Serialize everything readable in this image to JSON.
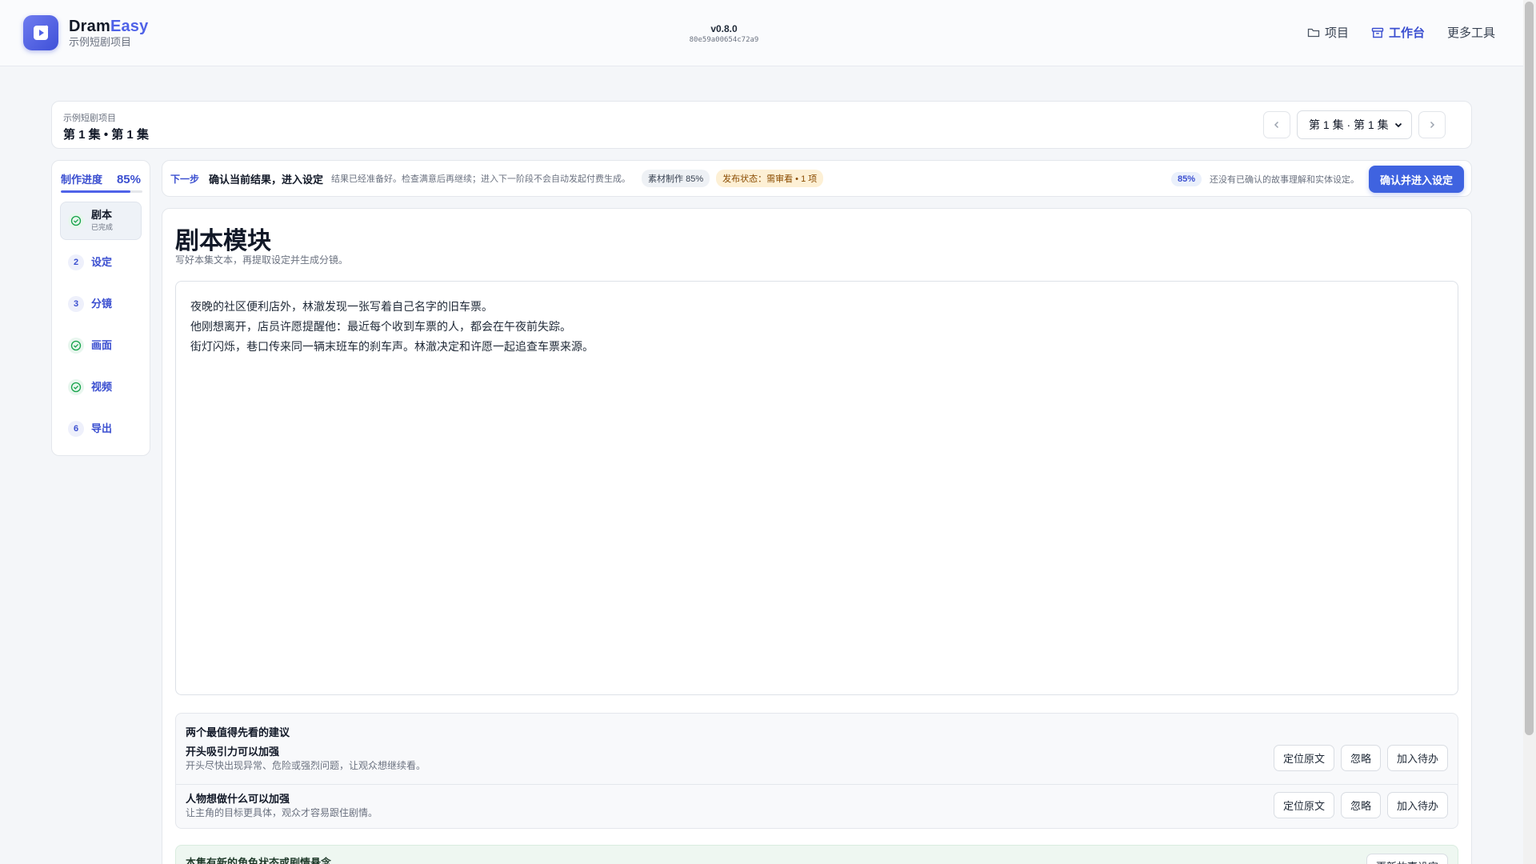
{
  "header": {
    "brand_main": "Dram",
    "brand_accent": "Easy",
    "project_name": "示例短剧项目",
    "version": "v0.8.0",
    "build_hash": "80e59a00654c72a9",
    "nav": [
      {
        "label": "项目",
        "icon": "folder-icon"
      },
      {
        "label": "工作台",
        "icon": "archive-icon",
        "active": true
      },
      {
        "label": "更多工具"
      }
    ]
  },
  "episode": {
    "project_label": "示例短剧项目",
    "title": "第 1 集 • 第 1 集",
    "selector_value": "第 1 集 · 第 1 集"
  },
  "sidebar": {
    "progress_label": "制作进度",
    "progress_value": "85%",
    "progress_fraction": 0.85,
    "steps": [
      {
        "badge": "",
        "label": "剧本",
        "sub": "已完成",
        "status": "done",
        "active": true
      },
      {
        "badge": "2",
        "label": "设定",
        "status": "pending"
      },
      {
        "badge": "3",
        "label": "分镜",
        "status": "pending"
      },
      {
        "badge": "",
        "label": "画面",
        "status": "done"
      },
      {
        "badge": "",
        "label": "视频",
        "status": "done"
      },
      {
        "badge": "6",
        "label": "导出",
        "status": "pending"
      }
    ]
  },
  "next_step": {
    "label": "下一步",
    "title": "确认当前结果，进入设定",
    "desc": "结果已经准备好。检查满意后再继续；进入下一阶段不会自动发起付费生成。",
    "chip_material": "素材制作 85%",
    "chip_publish": "发布状态：需审看 • 1 项",
    "percent": "85%",
    "hint": "还没有已确认的故事理解和实体设定。",
    "button": "确认并进入设定"
  },
  "main": {
    "title": "剧本模块",
    "subtitle": "写好本集文本，再提取设定并生成分镜。",
    "script_lines": [
      "夜晚的社区便利店外，林澈发现一张写着自己名字的旧车票。",
      "他刚想离开，店员许愿提醒他：最近每个收到车票的人，都会在午夜前失踪。",
      "街灯闪烁，巷口传来同一辆末班车的刹车声。林澈决定和许愿一起追查车票来源。"
    ],
    "suggestions_title": "两个最值得先看的建议",
    "suggestions": [
      {
        "title": "开头吸引力可以加强",
        "desc": "开头尽快出现异常、危险或强烈问题，让观众想继续看。"
      },
      {
        "title": "人物想做什么可以加强",
        "desc": "让主角的目标更具体，观众才容易跟住剧情。"
      }
    ],
    "actions": {
      "locate": "定位原文",
      "ignore": "忽略",
      "todo": "加入待办"
    },
    "state_title": "本集有新的角色状态或剧情悬念",
    "state_button": "更新故事设定"
  },
  "colors": {
    "accent": "#3f63e0",
    "brand": "#4f62e8",
    "done_green": "#16a34a",
    "warning_bg": "#fdf0d5"
  }
}
